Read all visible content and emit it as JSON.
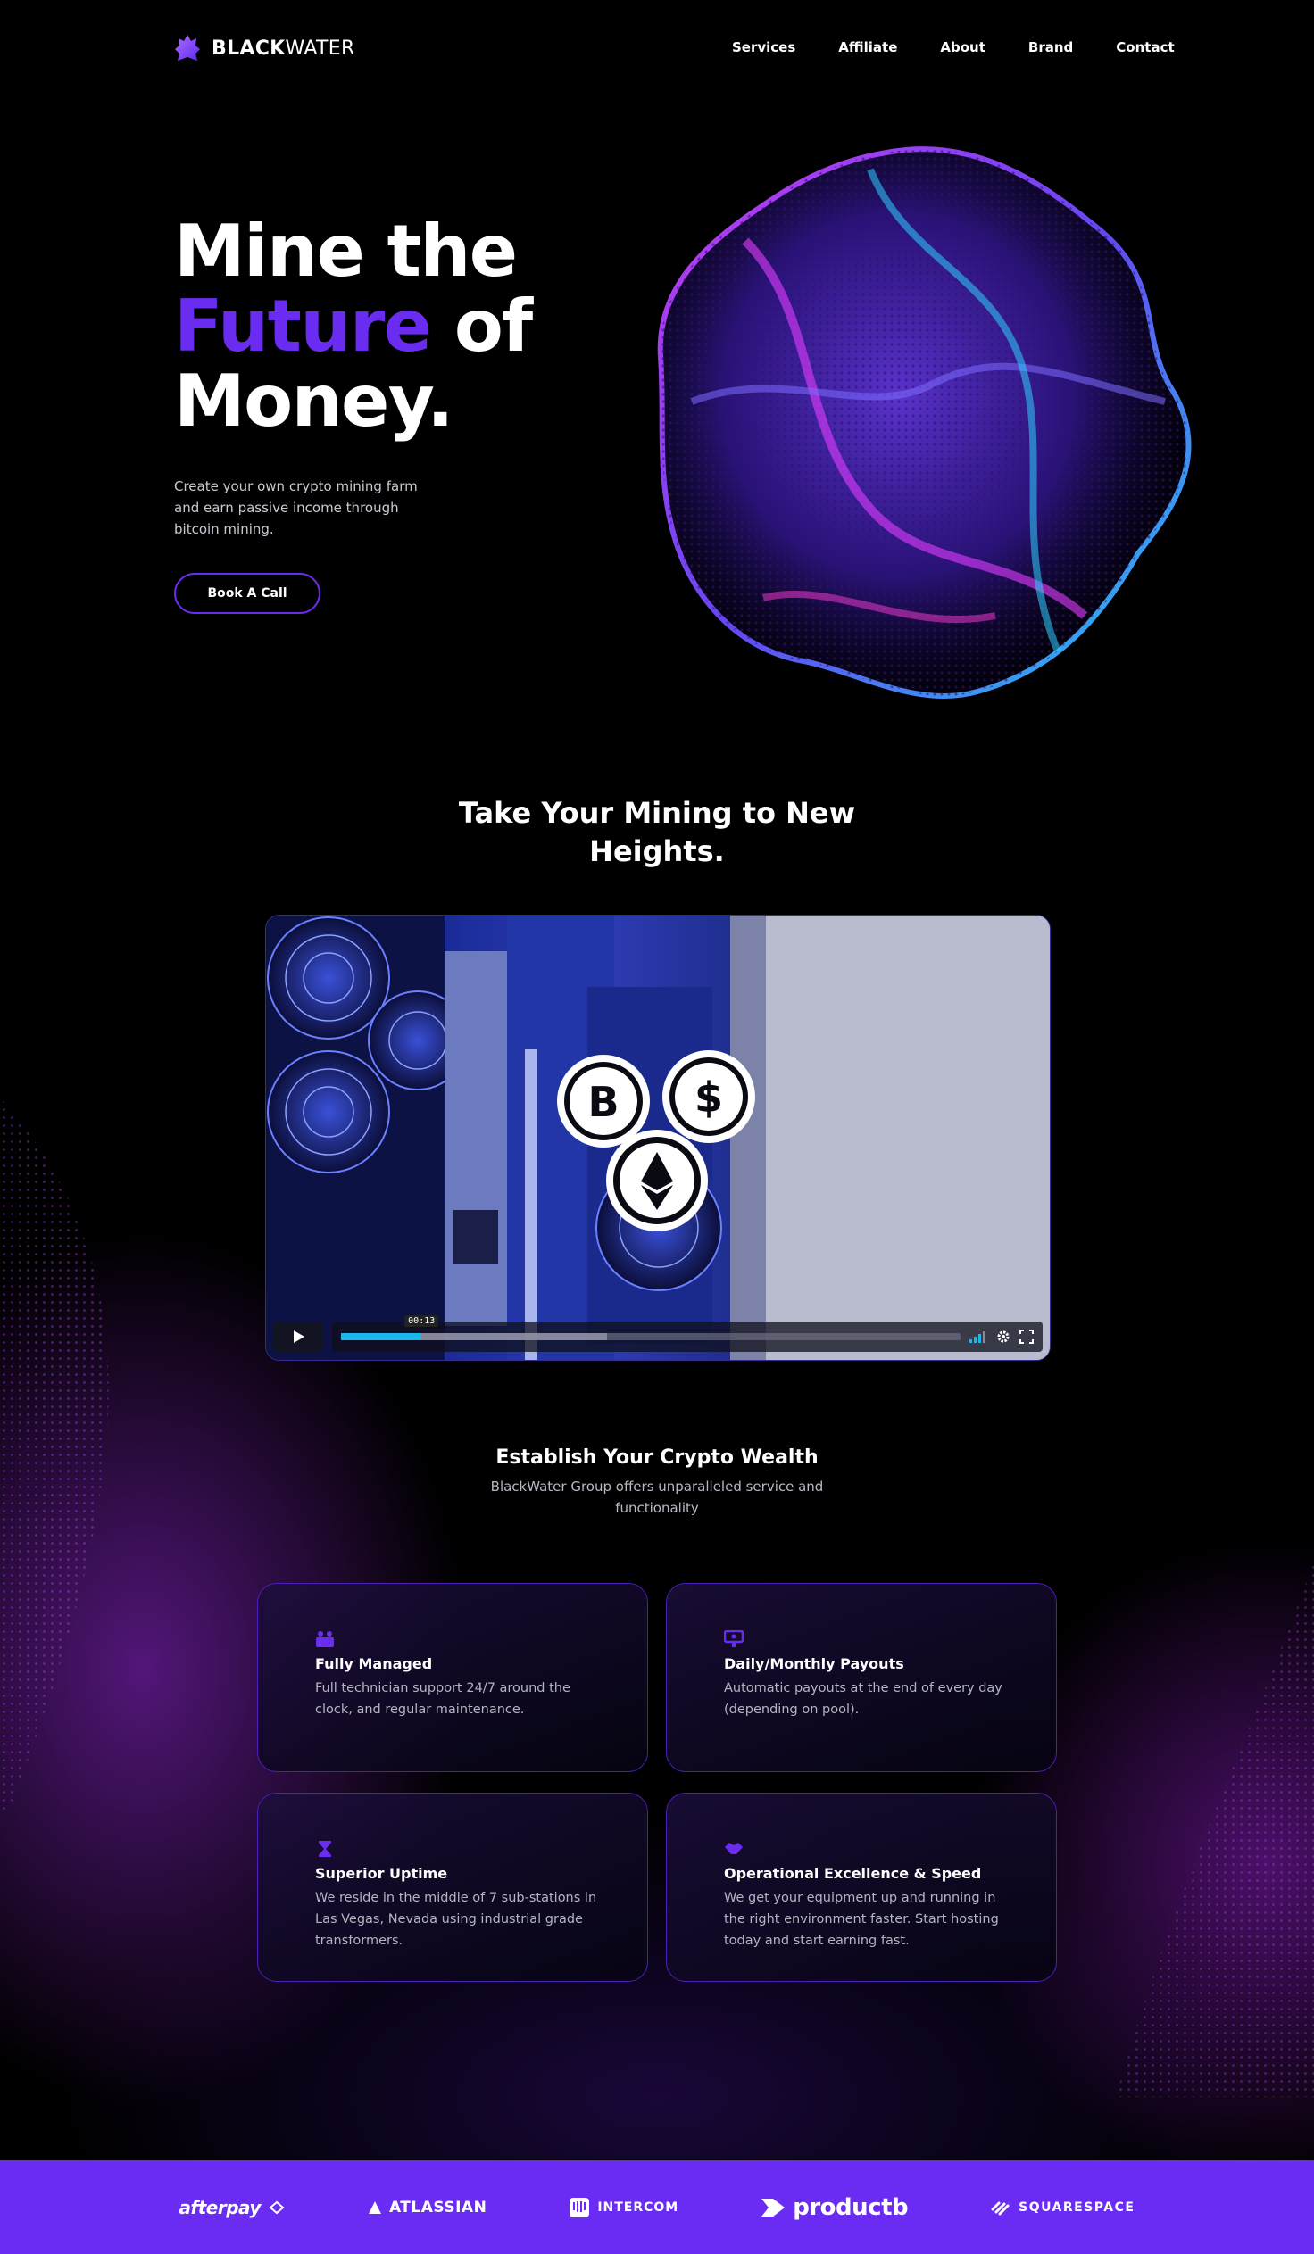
{
  "brand": {
    "name_bold": "BLACK",
    "name_light": "WATER"
  },
  "nav": {
    "items": [
      {
        "label": "Services"
      },
      {
        "label": "Affiliate"
      },
      {
        "label": "About"
      },
      {
        "label": "Brand"
      },
      {
        "label": "Contact"
      }
    ]
  },
  "hero": {
    "title_line1": "Mine the",
    "title_accent": "Future",
    "title_line2_rest": " of",
    "title_line3": "Money.",
    "subtitle": "Create your own crypto mining farm and earn passive income through bitcoin mining.",
    "cta_label": "Book A Call"
  },
  "video_section": {
    "title": "Take Your Mining to New Heights.",
    "player": {
      "time_tooltip": "00:13",
      "progress": 0.13,
      "loaded": 0.43
    }
  },
  "wealth": {
    "title": "Establish Your Crypto Wealth",
    "subtitle": "BlackWater Group offers unparalleled service and functionality"
  },
  "features": [
    {
      "icon": "team-icon",
      "title": "Fully Managed",
      "text": "Full technician support 24/7 around the clock, and regular maintenance."
    },
    {
      "icon": "payout-icon",
      "title": "Daily/Monthly Payouts",
      "text": "Automatic payouts at the end of every day (depending on pool)."
    },
    {
      "icon": "hourglass-icon",
      "title": "Superior Uptime",
      "text": "We reside in the middle of 7 sub-stations in Las Vegas, Nevada using industrial grade transformers."
    },
    {
      "icon": "handshake-icon",
      "title": "Operational Excellence & Speed",
      "text": "We get your equipment up and running in the right environment faster. Start hosting today and start earning fast."
    }
  ],
  "partners": [
    {
      "label": "afterpay"
    },
    {
      "label": "ATLASSIAN"
    },
    {
      "label": "INTERCOM"
    },
    {
      "label": "productb"
    },
    {
      "label": "SQUARESPACE"
    }
  ],
  "colors": {
    "background": "#000000",
    "accent": "#6a2cf0",
    "partner_bar": "#6a2cf3",
    "player_progress": "#1ab7ea"
  }
}
